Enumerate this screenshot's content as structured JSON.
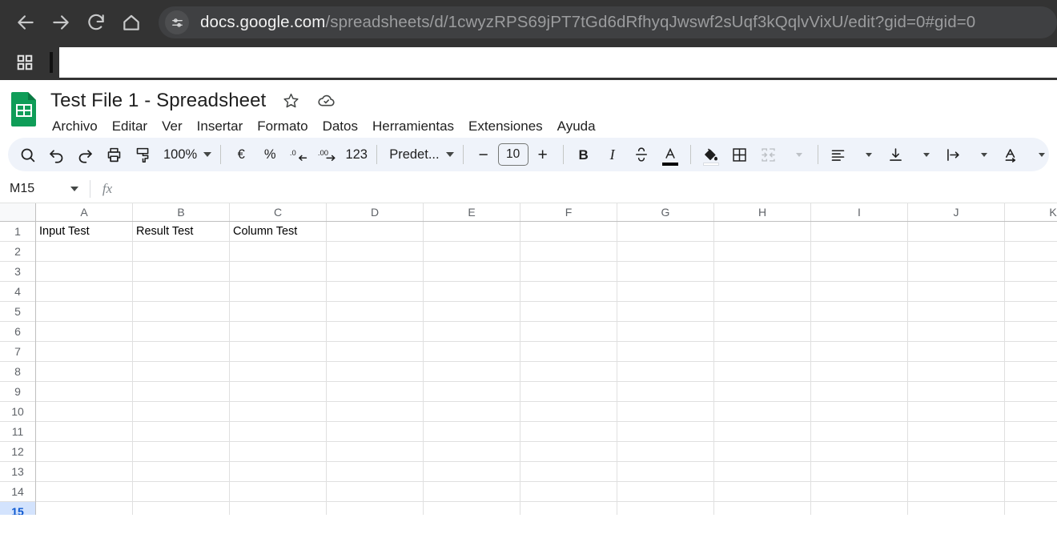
{
  "browser": {
    "nav": {
      "back": "back-arrow",
      "forward": "forward-arrow",
      "reload": "reload",
      "home": "home"
    },
    "url_host": "docs.google.com",
    "url_path": "/spreadsheets/d/1cwyzRPS69jPT7tGd6dRfhyqJwswf2sUqf3kQqlvVixU/edit?gid=0#gid=0",
    "chrome_bg": "#333333",
    "omnibox_bg": "#3f4042",
    "bookmark_value": ""
  },
  "doc": {
    "title": "Test File 1 - Spreadsheet",
    "star_tooltip": "star-icon",
    "cloud_tooltip": "cloud-saved-icon",
    "logo_color": "#0f9d58"
  },
  "menus": [
    {
      "label": "Archivo"
    },
    {
      "label": "Editar"
    },
    {
      "label": "Ver"
    },
    {
      "label": "Insertar"
    },
    {
      "label": "Formato"
    },
    {
      "label": "Datos"
    },
    {
      "label": "Herramientas"
    },
    {
      "label": "Extensiones"
    },
    {
      "label": "Ayuda"
    }
  ],
  "toolbar": {
    "zoom_level": "100%",
    "currency_symbol": "€",
    "percent_symbol": "%",
    "decrease_decimal": ".0",
    "increase_decimal": ".00",
    "number_format": "123",
    "font_family": "Predet...",
    "font_size": "10",
    "bold": "B",
    "italic": "I",
    "decrease_label": "−",
    "increase_label": "+",
    "accent": "#0b57d0",
    "bar_bg": "#eff3fa"
  },
  "formula_bar": {
    "name_box": "M15",
    "fx_label": "fx",
    "formula_value": ""
  },
  "grid": {
    "columns": [
      "A",
      "B",
      "C",
      "D",
      "E",
      "F",
      "G",
      "H",
      "I",
      "J",
      "K"
    ],
    "rows": [
      "1",
      "2",
      "3",
      "4",
      "5",
      "6",
      "7",
      "8",
      "9",
      "10",
      "11",
      "12",
      "13",
      "14",
      "15"
    ],
    "selected_row": "15",
    "selected_cell": "M15",
    "cell_values": [
      [
        "Input Test",
        "Result Test",
        "Column Test",
        "",
        "",
        "",
        "",
        "",
        "",
        "",
        ""
      ],
      [
        "",
        "",
        "",
        "",
        "",
        "",
        "",
        "",
        "",
        "",
        ""
      ],
      [
        "",
        "",
        "",
        "",
        "",
        "",
        "",
        "",
        "",
        "",
        ""
      ],
      [
        "",
        "",
        "",
        "",
        "",
        "",
        "",
        "",
        "",
        "",
        ""
      ],
      [
        "",
        "",
        "",
        "",
        "",
        "",
        "",
        "",
        "",
        "",
        ""
      ],
      [
        "",
        "",
        "",
        "",
        "",
        "",
        "",
        "",
        "",
        "",
        ""
      ],
      [
        "",
        "",
        "",
        "",
        "",
        "",
        "",
        "",
        "",
        "",
        ""
      ],
      [
        "",
        "",
        "",
        "",
        "",
        "",
        "",
        "",
        "",
        "",
        ""
      ],
      [
        "",
        "",
        "",
        "",
        "",
        "",
        "",
        "",
        "",
        "",
        ""
      ],
      [
        "",
        "",
        "",
        "",
        "",
        "",
        "",
        "",
        "",
        "",
        ""
      ],
      [
        "",
        "",
        "",
        "",
        "",
        "",
        "",
        "",
        "",
        "",
        ""
      ],
      [
        "",
        "",
        "",
        "",
        "",
        "",
        "",
        "",
        "",
        "",
        ""
      ],
      [
        "",
        "",
        "",
        "",
        "",
        "",
        "",
        "",
        "",
        "",
        ""
      ],
      [
        "",
        "",
        "",
        "",
        "",
        "",
        "",
        "",
        "",
        "",
        ""
      ],
      [
        "",
        "",
        "",
        "",
        "",
        "",
        "",
        "",
        "",
        "",
        ""
      ]
    ]
  }
}
